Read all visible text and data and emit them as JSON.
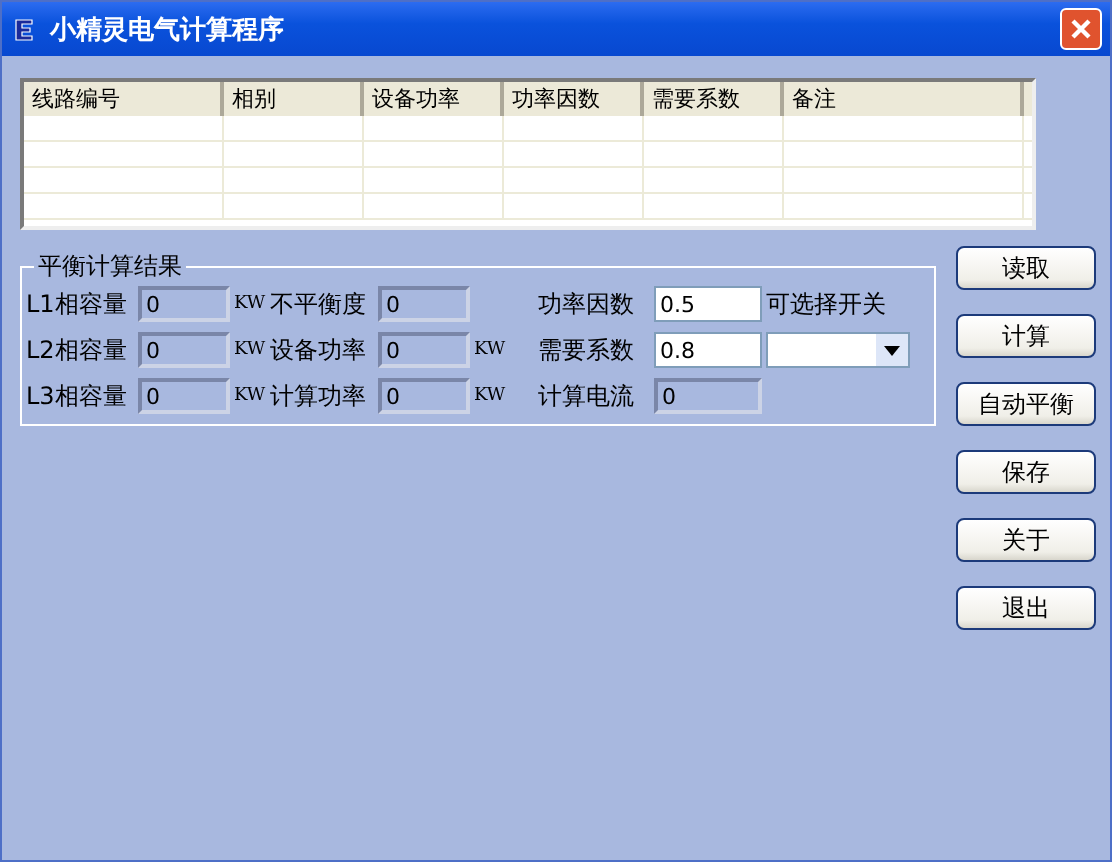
{
  "window": {
    "title": "小精灵电气计算程序"
  },
  "table": {
    "columns": [
      "线路编号",
      "相别",
      "设备功率",
      "功率因数",
      "需要系数",
      "备注"
    ]
  },
  "balance_group": {
    "title": "平衡计算结果",
    "rows": [
      {
        "left": {
          "label": "L1相容量",
          "value": "0",
          "unit": "KW",
          "readonly": true
        },
        "middle": {
          "label": "不平衡度",
          "value": "0",
          "readonly": true
        },
        "right": {
          "label": "功率因数",
          "value": "0.5",
          "readonly": false
        }
      },
      {
        "left": {
          "label": "L2相容量",
          "value": "0",
          "unit": "KW",
          "readonly": true
        },
        "middle": {
          "label": "设备功率",
          "value": "0",
          "unit": "KW",
          "readonly": true
        },
        "right": {
          "label": "需要系数",
          "value": "0.8",
          "readonly": false
        }
      },
      {
        "left": {
          "label": "L3相容量",
          "value": "0",
          "unit": "KW",
          "readonly": true
        },
        "middle": {
          "label": "计算功率",
          "value": "0",
          "unit": "KW",
          "readonly": true
        },
        "right": {
          "label": "计算电流",
          "value": "0",
          "readonly": true
        }
      }
    ],
    "switch": {
      "label": "可选择开关"
    }
  },
  "buttons": [
    "读取",
    "计算",
    "自动平衡",
    "保存",
    "关于",
    "退出"
  ]
}
